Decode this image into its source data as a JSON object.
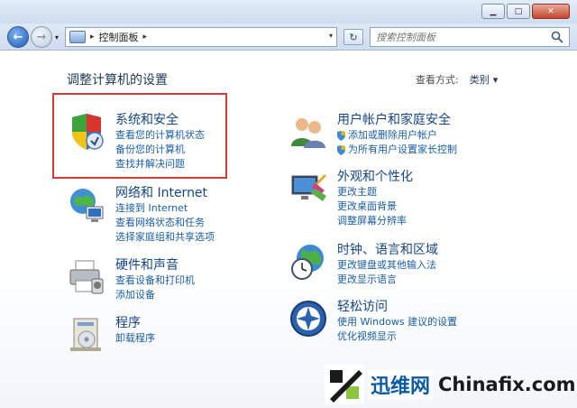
{
  "window": {
    "minimize_glyph": "▁",
    "maximize_glyph": "□",
    "close_glyph": "✕"
  },
  "nav": {
    "back_glyph": "←",
    "forward_glyph": "→",
    "dropdown_glyph": "▾",
    "refresh_glyph": "↻"
  },
  "address": {
    "separator": "▸",
    "path": "控制面板",
    "trail": "▸"
  },
  "search": {
    "placeholder": "搜索控制面板"
  },
  "main": {
    "title": "调整计算机的设置",
    "view_by_label": "查看方式:",
    "view_by_value": "类别",
    "view_by_caret": "▾"
  },
  "categories": [
    {
      "id": "system-security",
      "title": "系统和安全",
      "links": [
        "查看您的计算机状态",
        "备份您的计算机",
        "查找并解决问题"
      ],
      "icon": "shield-icon"
    },
    {
      "id": "network-internet",
      "title": "网络和 Internet",
      "links": [
        "连接到 Internet",
        "查看网络状态和任务",
        "选择家庭组和共享选项"
      ],
      "icon": "network-icon"
    },
    {
      "id": "hardware-sound",
      "title": "硬件和声音",
      "links": [
        "查看设备和打印机",
        "添加设备"
      ],
      "icon": "printer-icon"
    },
    {
      "id": "programs",
      "title": "程序",
      "links": [
        "卸载程序"
      ],
      "icon": "programs-icon"
    },
    {
      "id": "user-accounts",
      "title": "用户帐户和家庭安全",
      "links": [
        "添加或删除用户帐户",
        "为所有用户设置家长控制"
      ],
      "icon": "users-icon"
    },
    {
      "id": "appearance",
      "title": "外观和个性化",
      "links": [
        "更改主题",
        "更改桌面背景",
        "调整屏幕分辨率"
      ],
      "icon": "appearance-icon"
    },
    {
      "id": "clock-region",
      "title": "时钟、语言和区域",
      "links": [
        "更改键盘或其他输入法",
        "更改显示语言"
      ],
      "icon": "globe-clock-icon"
    },
    {
      "id": "ease-of-access",
      "title": "轻松访问",
      "links": [
        "使用 Windows 建议的设置",
        "优化视频显示"
      ],
      "icon": "ease-of-access-icon"
    }
  ],
  "watermark": {
    "cn": "迅维网",
    "en": "Chinafix.com"
  },
  "colors": {
    "link": "#1a5ea8",
    "title": "#14458a",
    "highlight": "#d83a3a"
  }
}
